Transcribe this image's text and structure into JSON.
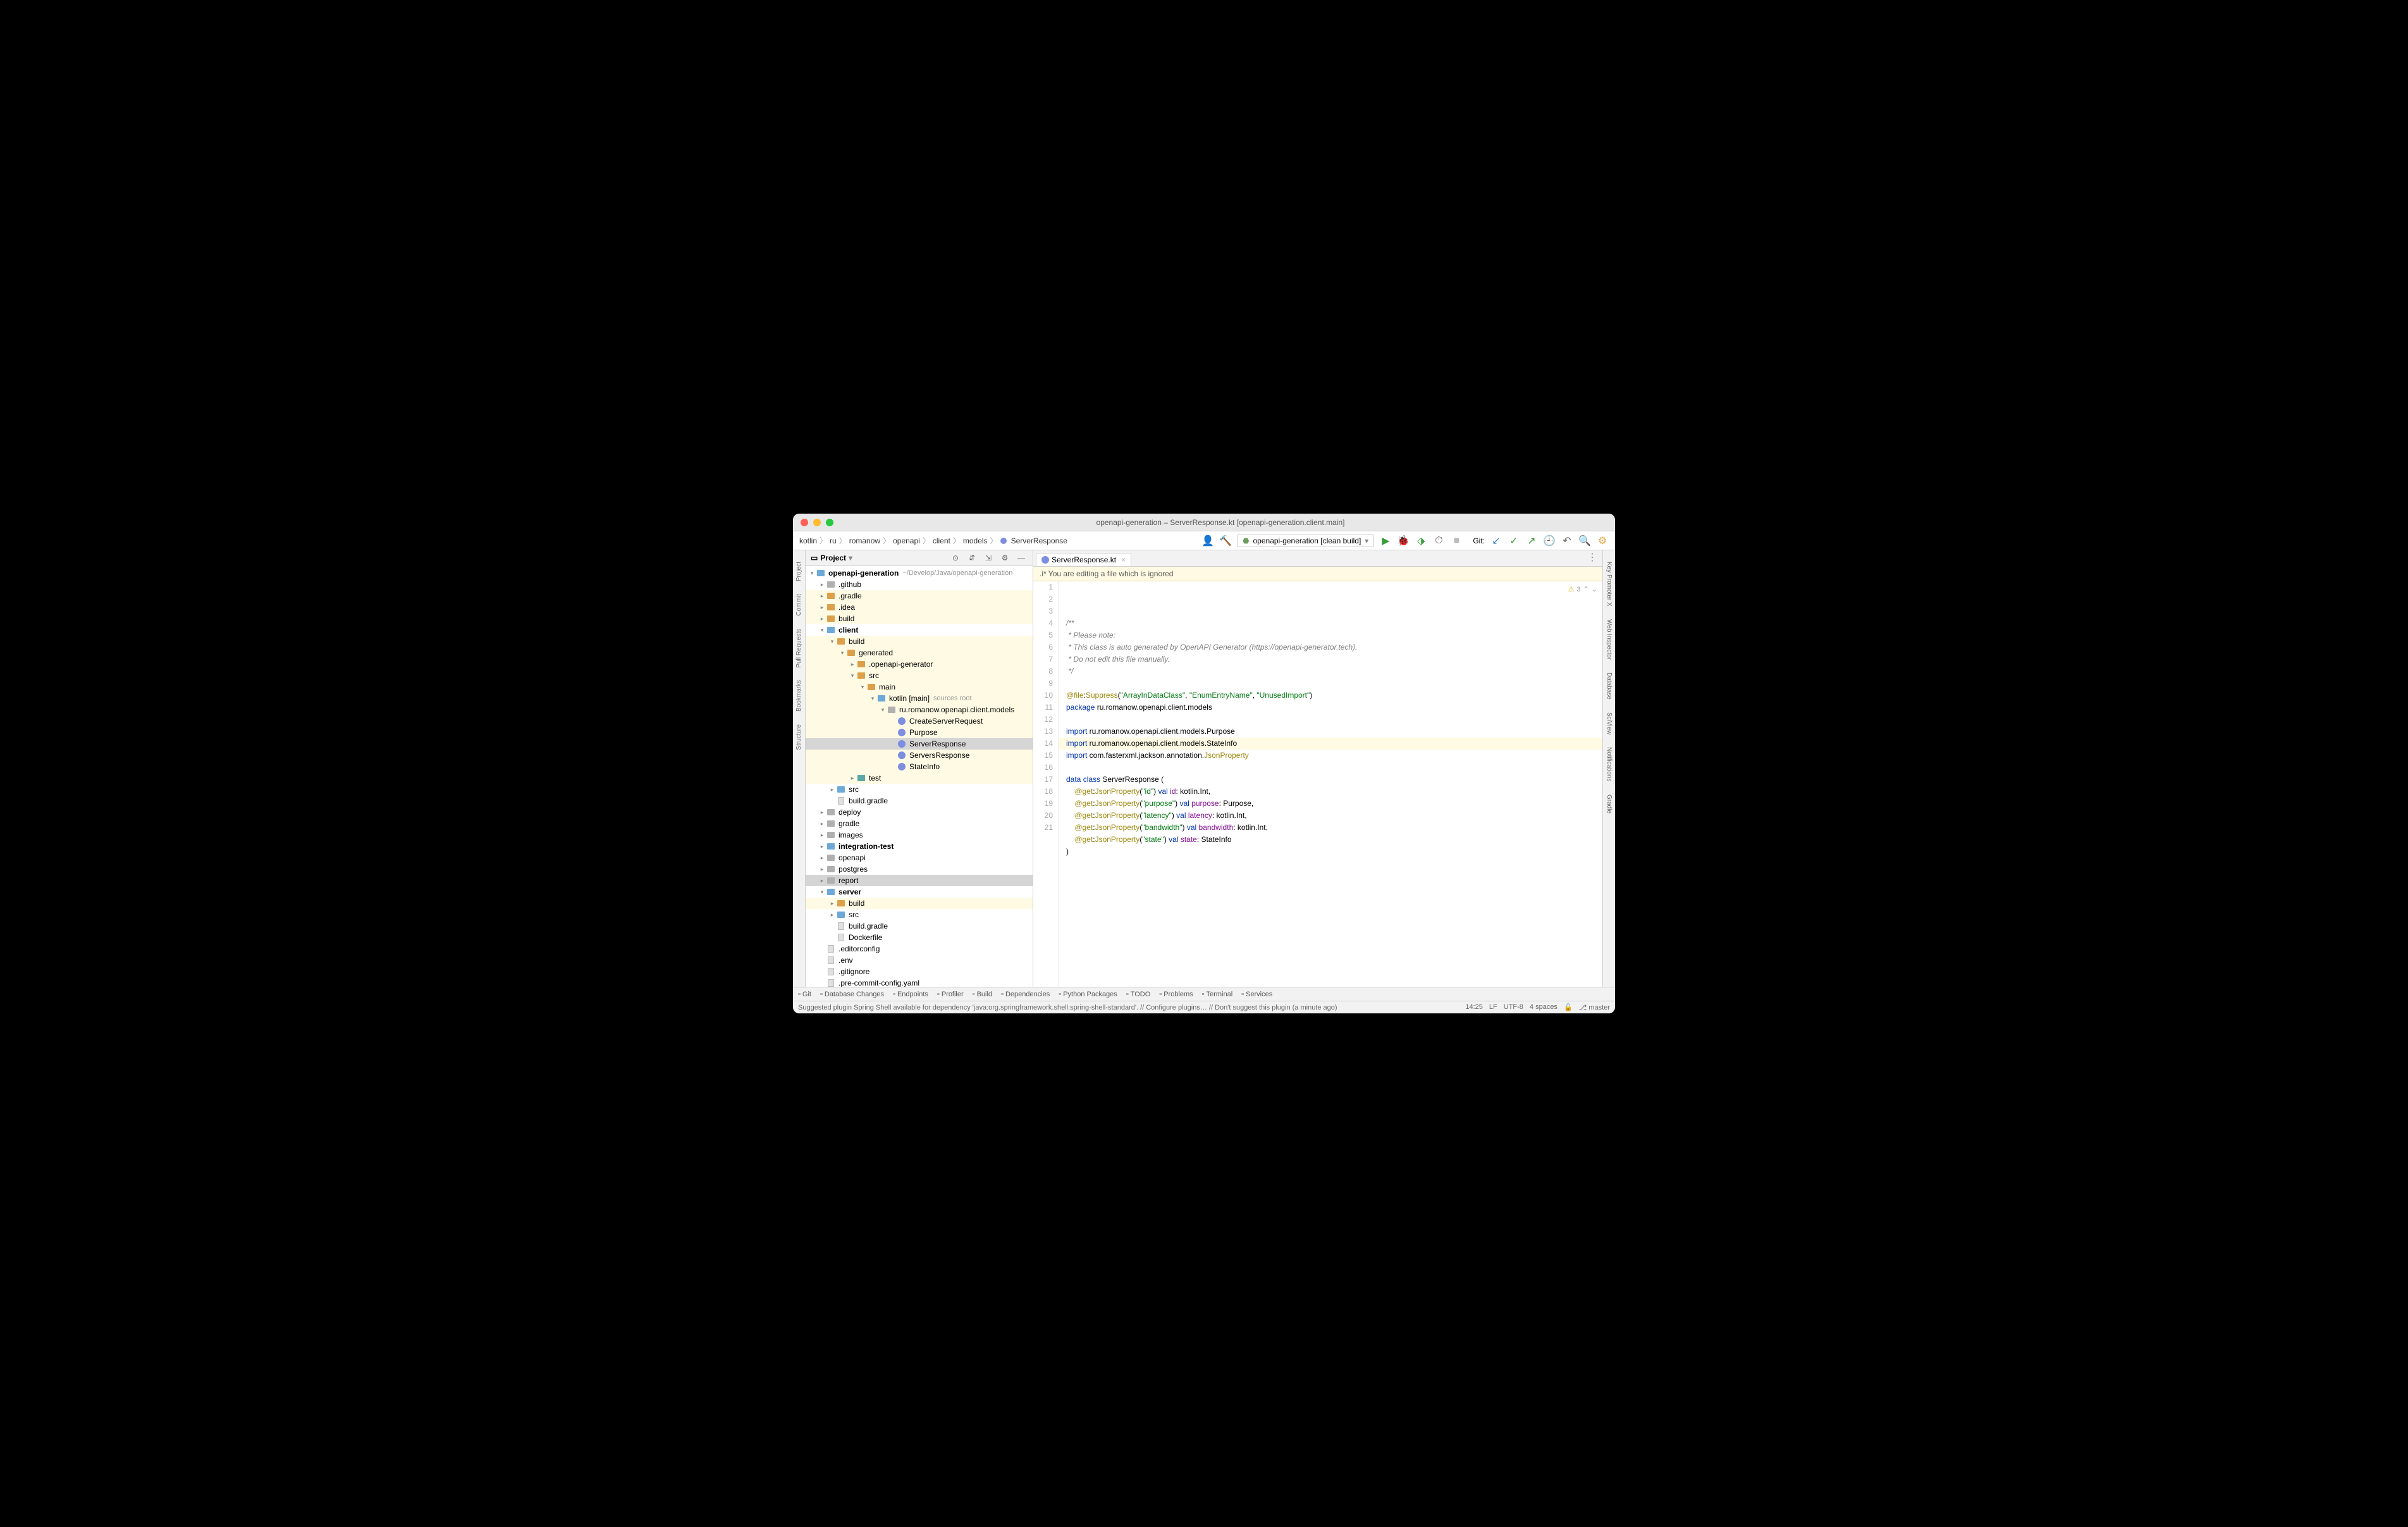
{
  "title": "openapi-generation – ServerResponse.kt [openapi-generation.client.main]",
  "breadcrumb": [
    "kotlin",
    "ru",
    "romanow",
    "openapi",
    "client",
    "models",
    "ServerResponse"
  ],
  "run_config": "openapi-generation [clean build]",
  "git_label": "Git:",
  "panel": {
    "title": "Project"
  },
  "tree": {
    "root": {
      "name": "openapi-generation",
      "path": "~/Develop/Java/openapi-generation"
    },
    "items": [
      {
        "d": 1,
        "t": "folder",
        "c": "gray",
        "n": ".github",
        "arrow": ">"
      },
      {
        "d": 1,
        "t": "folder",
        "c": "orange",
        "n": ".gradle",
        "arrow": ">",
        "hl": true
      },
      {
        "d": 1,
        "t": "folder",
        "c": "orange",
        "n": ".idea",
        "arrow": ">",
        "hl": true
      },
      {
        "d": 1,
        "t": "folder",
        "c": "orange",
        "n": "build",
        "arrow": ">",
        "hl": true
      },
      {
        "d": 1,
        "t": "folder",
        "c": "blue",
        "n": "client",
        "bold": true,
        "arrow": "v"
      },
      {
        "d": 2,
        "t": "folder",
        "c": "orange",
        "n": "build",
        "arrow": "v",
        "hl": true
      },
      {
        "d": 3,
        "t": "folder",
        "c": "orange",
        "n": "generated",
        "arrow": "v",
        "hl": true
      },
      {
        "d": 4,
        "t": "folder",
        "c": "orange",
        "n": ".openapi-generator",
        "arrow": ">",
        "hl": true
      },
      {
        "d": 4,
        "t": "folder",
        "c": "orange",
        "n": "src",
        "arrow": "v",
        "hl": true
      },
      {
        "d": 5,
        "t": "folder",
        "c": "orange",
        "n": "main",
        "arrow": "v",
        "hl": true
      },
      {
        "d": 6,
        "t": "folder",
        "c": "blue",
        "n": "kotlin [main]",
        "meta": "sources root",
        "arrow": "v",
        "hl": true
      },
      {
        "d": 7,
        "t": "folder",
        "c": "gray",
        "n": "ru.romanow.openapi.client.models",
        "arrow": "v",
        "hl": true
      },
      {
        "d": 8,
        "t": "kt",
        "n": "CreateServerRequest",
        "hl": true
      },
      {
        "d": 8,
        "t": "kt",
        "n": "Purpose",
        "hl": true
      },
      {
        "d": 8,
        "t": "kt",
        "n": "ServerResponse",
        "sel": true
      },
      {
        "d": 8,
        "t": "kt",
        "n": "ServersResponse",
        "hl": true
      },
      {
        "d": 8,
        "t": "kt",
        "n": "StateInfo",
        "hl": true
      },
      {
        "d": 4,
        "t": "folder",
        "c": "teal",
        "n": "test",
        "arrow": ">",
        "hl": true
      },
      {
        "d": 2,
        "t": "folder",
        "c": "blue",
        "n": "src",
        "arrow": ">"
      },
      {
        "d": 2,
        "t": "file",
        "n": "build.gradle",
        "icon": "gradle"
      },
      {
        "d": 1,
        "t": "folder",
        "c": "gray",
        "n": "deploy",
        "arrow": ">"
      },
      {
        "d": 1,
        "t": "folder",
        "c": "gray",
        "n": "gradle",
        "arrow": ">"
      },
      {
        "d": 1,
        "t": "folder",
        "c": "gray",
        "n": "images",
        "arrow": ">"
      },
      {
        "d": 1,
        "t": "folder",
        "c": "blue",
        "n": "integration-test",
        "bold": true,
        "arrow": ">"
      },
      {
        "d": 1,
        "t": "folder",
        "c": "gray",
        "n": "openapi",
        "arrow": ">"
      },
      {
        "d": 1,
        "t": "folder",
        "c": "gray",
        "n": "postgres",
        "arrow": ">"
      },
      {
        "d": 1,
        "t": "folder",
        "c": "gray",
        "n": "report",
        "arrow": ">",
        "sel2": true
      },
      {
        "d": 1,
        "t": "folder",
        "c": "blue",
        "n": "server",
        "bold": true,
        "arrow": "v"
      },
      {
        "d": 2,
        "t": "folder",
        "c": "orange",
        "n": "build",
        "arrow": ">",
        "hl": true
      },
      {
        "d": 2,
        "t": "folder",
        "c": "blue",
        "n": "src",
        "arrow": ">"
      },
      {
        "d": 2,
        "t": "file",
        "n": "build.gradle",
        "icon": "gradle"
      },
      {
        "d": 2,
        "t": "file",
        "n": "Dockerfile",
        "icon": "docker"
      },
      {
        "d": 1,
        "t": "file",
        "n": ".editorconfig"
      },
      {
        "d": 1,
        "t": "file",
        "n": ".env"
      },
      {
        "d": 1,
        "t": "file",
        "n": ".gitignore"
      },
      {
        "d": 1,
        "t": "file",
        "n": ".pre-commit-config.yaml"
      }
    ]
  },
  "tab": {
    "name": "ServerResponse.kt"
  },
  "notice": ".i* You are editing a file which is ignored",
  "inspect": {
    "warn": "3"
  },
  "code_lines": [
    {
      "n": 1,
      "html": "<span class='c-comment'>/**</span>"
    },
    {
      "n": 2,
      "html": "<span class='c-comment'> * Please note:</span>"
    },
    {
      "n": 3,
      "html": "<span class='c-comment'> * This class is auto generated by OpenAPI Generator (https://openapi-generator.tech).</span>"
    },
    {
      "n": 4,
      "html": "<span class='c-comment'> * Do not edit this file manually.</span>"
    },
    {
      "n": 5,
      "html": "<span class='c-comment'> */</span>"
    },
    {
      "n": 6,
      "html": ""
    },
    {
      "n": 7,
      "html": "<span class='c-ann'>@file</span>:<span class='c-ann'>Suppress</span>(<span class='c-str'>\"ArrayInDataClass\"</span>, <span class='c-str'>\"EnumEntryName\"</span>, <span class='c-str'>\"UnusedImport\"</span>)"
    },
    {
      "n": 8,
      "html": "<span class='c-kw'>package</span> ru.romanow.openapi.client.models"
    },
    {
      "n": 9,
      "html": ""
    },
    {
      "n": 10,
      "html": "<span class='c-kw'>import</span> ru.romanow.openapi.client.models.Purpose"
    },
    {
      "n": 11,
      "html": "<span class='c-kw'>import</span> ru.romanow.openapi.client.models.StateInfo"
    },
    {
      "n": 12,
      "html": "<span class='c-kw'>import</span> com.fasterxml.jackson.annotation.<span class='c-ann'>JsonProperty</span>"
    },
    {
      "n": 13,
      "html": ""
    },
    {
      "n": 14,
      "html": "<span class='c-kw'>data</span> <span class='c-kw'>class</span> ServerResponse (",
      "hl": true
    },
    {
      "n": 15,
      "html": "    <span class='c-ann'>@get</span>:<span class='c-ann'>JsonProperty</span>(<span class='c-str'>\"id\"</span>) <span class='c-kw'>val</span> <span class='c-prop'>id</span>: kotlin.Int,"
    },
    {
      "n": 16,
      "html": "    <span class='c-ann'>@get</span>:<span class='c-ann'>JsonProperty</span>(<span class='c-str'>\"purpose\"</span>) <span class='c-kw'>val</span> <span class='c-prop'>purpose</span>: Purpose,"
    },
    {
      "n": 17,
      "html": "    <span class='c-ann'>@get</span>:<span class='c-ann'>JsonProperty</span>(<span class='c-str'>\"latency\"</span>) <span class='c-kw'>val</span> <span class='c-prop'>latency</span>: kotlin.Int,"
    },
    {
      "n": 18,
      "html": "    <span class='c-ann'>@get</span>:<span class='c-ann'>JsonProperty</span>(<span class='c-str'>\"bandwidth\"</span>) <span class='c-kw'>val</span> <span class='c-prop'>bandwidth</span>: kotlin.Int,"
    },
    {
      "n": 19,
      "html": "    <span class='c-ann'>@get</span>:<span class='c-ann'>JsonProperty</span>(<span class='c-str'>\"state\"</span>) <span class='c-kw'>val</span> <span class='c-prop'>state</span>: StateInfo"
    },
    {
      "n": 20,
      "html": ")"
    },
    {
      "n": 21,
      "html": ""
    }
  ],
  "left_tools": [
    "Project",
    "Commit",
    "Pull Requests",
    "Bookmarks",
    "Structure"
  ],
  "right_tools": [
    "Key Promoter X",
    "Web Inspector",
    "Database",
    "SciView",
    "Notifications",
    "Gradle"
  ],
  "bottom_tools": [
    "Git",
    "Database Changes",
    "Endpoints",
    "Profiler",
    "Build",
    "Dependencies",
    "Python Packages",
    "TODO",
    "Problems",
    "Terminal",
    "Services"
  ],
  "status": {
    "msg": "Suggested plugin Spring Shell available for dependency 'java:org.springframework.shell:spring-shell-standard'. // Configure plugins… // Don't suggest this plugin (a minute ago)",
    "time": "14:25",
    "encoding": "LF",
    "charset": "UTF-8",
    "indent": "4 spaces",
    "branch": "master"
  }
}
